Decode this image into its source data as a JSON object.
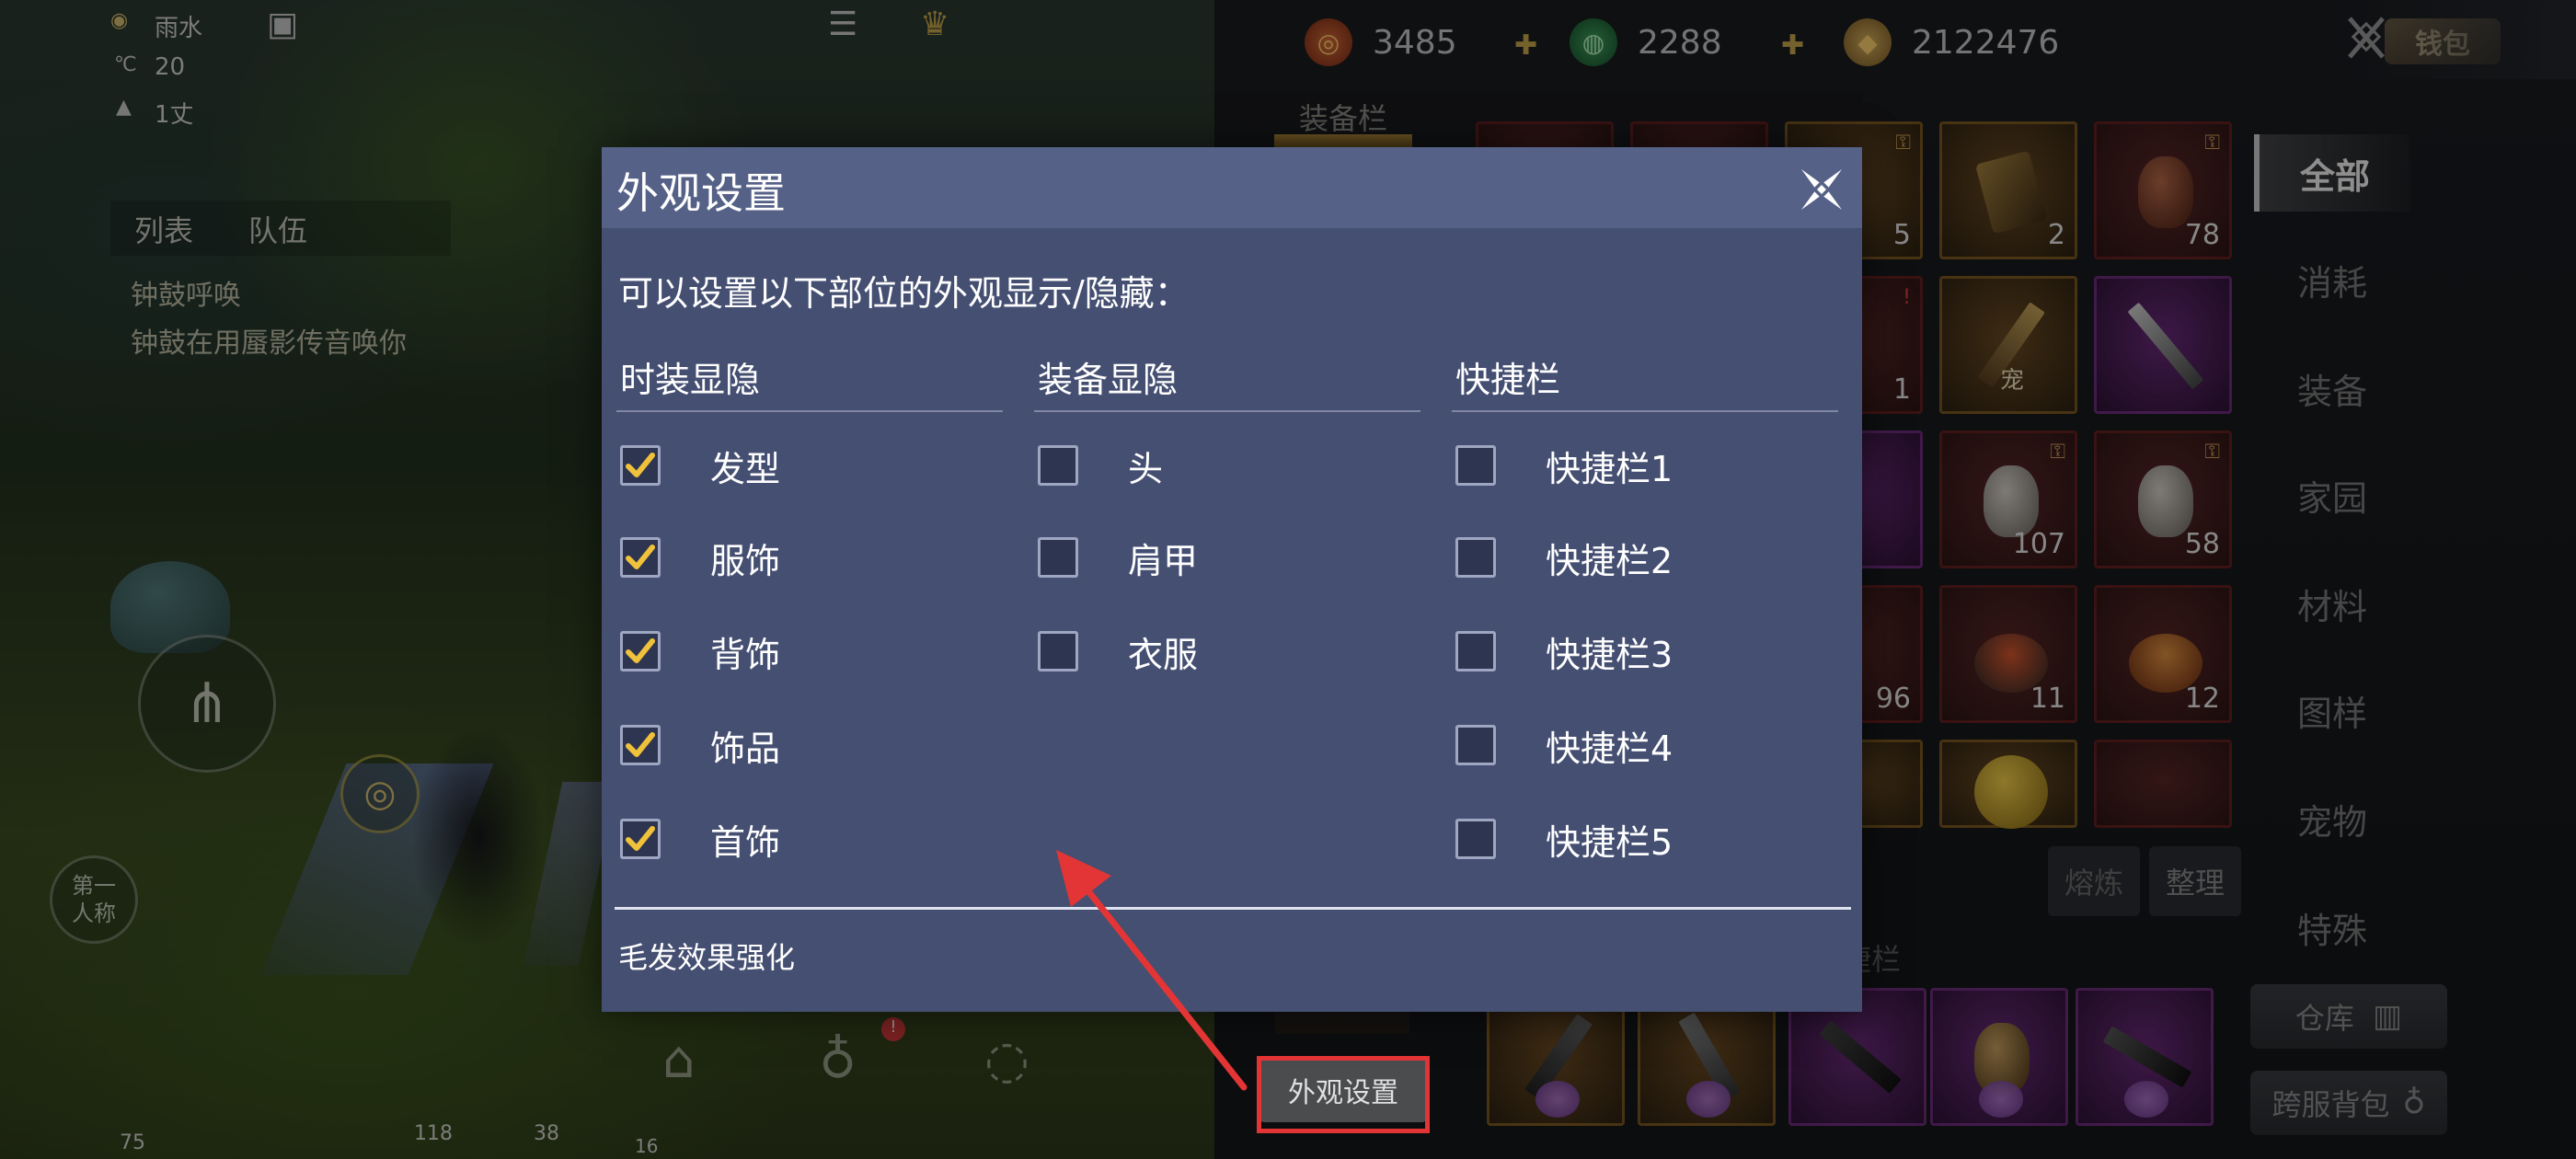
{
  "hud": {
    "weather": "雨水",
    "temperature": "20",
    "distance": "1丈",
    "list_tab": "列表",
    "team_tab": "队伍",
    "chat_line_1": "钟鼓呼唤",
    "chat_line_2": "钟鼓在用蜃影传音唤你",
    "first_person_label": "第一\n人称",
    "ping": "75",
    "signal": "118",
    "fps": "38",
    "level": "16"
  },
  "currency": {
    "red": "3485",
    "jade": "2288",
    "gold": "2122476",
    "wallet_label": "钱包"
  },
  "inventory": {
    "equip_tab_title": "装备栏",
    "shortcut_title": "快捷栏",
    "refine_label": "熔炼",
    "sort_label": "整理",
    "warehouse_label": "仓库",
    "cross_server_label": "跨服背包",
    "appearance_button": "外观设置",
    "pet_mark": "宠",
    "slot_counts": [
      "5",
      "2",
      "78",
      "1",
      "107",
      "58",
      "96",
      "11",
      "12"
    ],
    "categories": [
      "全部",
      "消耗",
      "装备",
      "家园",
      "材料",
      "图样",
      "宠物",
      "特殊"
    ]
  },
  "dialog": {
    "title": "外观设置",
    "description": "可以设置以下部位的外观显示/隐藏：",
    "columns": [
      {
        "header": "时装显隐",
        "options": [
          {
            "label": "发型",
            "checked": true
          },
          {
            "label": "服饰",
            "checked": true
          },
          {
            "label": "背饰",
            "checked": true
          },
          {
            "label": "饰品",
            "checked": true
          },
          {
            "label": "首饰",
            "checked": true
          }
        ]
      },
      {
        "header": "装备显隐",
        "options": [
          {
            "label": "头",
            "checked": false
          },
          {
            "label": "肩甲",
            "checked": false
          },
          {
            "label": "衣服",
            "checked": false
          }
        ]
      },
      {
        "header": "快捷栏",
        "options": [
          {
            "label": "快捷栏1",
            "checked": false
          },
          {
            "label": "快捷栏2",
            "checked": false
          },
          {
            "label": "快捷栏3",
            "checked": false
          },
          {
            "label": "快捷栏4",
            "checked": false
          },
          {
            "label": "快捷栏5",
            "checked": false
          }
        ]
      }
    ],
    "footer_label": "毛发效果强化"
  },
  "colors": {
    "dialog_bg": "#454f72",
    "dialog_titlebar": "#556187",
    "checkmark": "#f0c13a",
    "highlight_red": "#e33535"
  },
  "icons": {
    "close": "close-x-icon",
    "check": "checkmark-icon",
    "arrow": "red-arrow-icon"
  }
}
